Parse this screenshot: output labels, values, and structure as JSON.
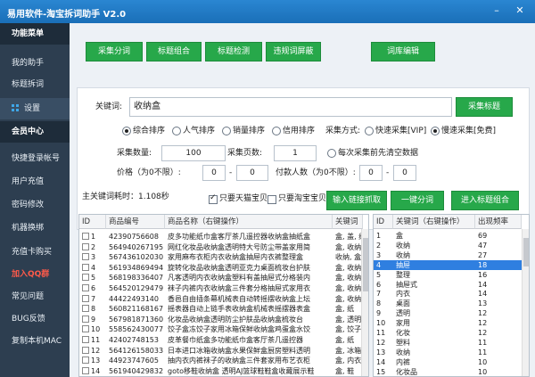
{
  "window": {
    "title": "易用软件-淘宝拆词助手 V2.0",
    "min": "–",
    "close": "✕"
  },
  "sidebar": {
    "items": [
      {
        "label": "功能菜单",
        "section": true
      },
      {
        "label": "我的助手"
      },
      {
        "label": "标题拆词"
      },
      {
        "label": "设置",
        "icon": "grid-icon",
        "active": true
      },
      {
        "label": "会员中心",
        "section": true
      },
      {
        "label": "快捷登录帐号"
      },
      {
        "label": "用户充值"
      },
      {
        "label": "密码修改"
      },
      {
        "label": "机器换绑"
      },
      {
        "label": "充值卡购买"
      },
      {
        "label": "加入QQ群",
        "red": true
      },
      {
        "label": "常见问题"
      },
      {
        "label": "BUG反馈"
      },
      {
        "label": "复制本机MAC"
      }
    ]
  },
  "toolbar": {
    "collect": "采集分词",
    "combine": "标题组合",
    "detect": "标题检测",
    "violation": "违规词屏蔽",
    "edit": "词库编辑"
  },
  "search": {
    "keyword_label": "关键词:",
    "keyword_value": "收纳盒",
    "collect_titles_btn": "采集标题",
    "sort": [
      {
        "label": "综合排序",
        "checked": true
      },
      {
        "label": "人气排序",
        "checked": false
      },
      {
        "label": "销量排序",
        "checked": false
      },
      {
        "label": "信用排序",
        "checked": false
      }
    ],
    "method_label": "采集方式:",
    "methods": [
      {
        "label": "快速采集[VIP]",
        "checked": false
      },
      {
        "label": "慢速采集[免费]",
        "checked": true
      }
    ],
    "count_label": "采集数量:",
    "count_value": "100",
    "pages_label": "采集页数:",
    "pages_value": "1",
    "clear_label": "每次采集前先清空数据",
    "price_label": "价格（为0不限）:",
    "price_min": "0",
    "price_max": "0",
    "price_dash": "-",
    "buyers_label": "付款人数（为0不限）:",
    "buyers_min": "0",
    "buyers_max": "0",
    "buyers_dash": "-"
  },
  "actions": {
    "time_label": "主关键词耗时：1.108秒",
    "tmall_only": "只要天猫宝贝",
    "taobao_only": "只要淘宝宝贝",
    "import_btn": "输入链接抓取",
    "onekey_btn": "一键分词",
    "combine_btn": "进入标题组合"
  },
  "left_table": {
    "headers": [
      "ID",
      "商品编号",
      "商品名称（右键操作）",
      "关键词"
    ],
    "rows": [
      [
        "1",
        "42390756608",
        "皮多功能纸巾盒客厅茶几遥控器收纳盒抽纸盒",
        "盒, 盖, 纸"
      ],
      [
        "2",
        "564940267195",
        "网红化妆品收纳盒透明特大号防尘带盖家用简",
        "盒, 收纳"
      ],
      [
        "3",
        "567436102030",
        "家用麻布衣柜内衣收纳盒抽屉内衣裤整理盒",
        "收纳, 盒"
      ],
      [
        "4",
        "561934869494",
        "旋转化妆品收纳盒透明亚克力桌面梳妆台护肤",
        "盒, 收纳"
      ],
      [
        "5",
        "568198336407",
        "凡客透明内衣收纳盒塑料有盖抽屉式分格装内",
        "盒, 收纳"
      ],
      [
        "6",
        "564520129479",
        "袜子内裤内衣收纳盒三件套分格抽屉式家用衣",
        "盒, 收纳"
      ],
      [
        "7",
        "44422493140",
        "香邑自由插条幕机械表自动转摇摆收纳盒上坛",
        "盒, 收纳"
      ],
      [
        "8",
        "560821168167",
        "摇表器自动上链手表收纳盒机械表摇摆器表盒",
        "盒, 纸"
      ],
      [
        "9",
        "567981871360",
        "化妆品收纳盒透明防尘护肤品收纳盒梳妆台",
        "盒, 透明"
      ],
      [
        "10",
        "558562430077",
        "饺子盒冻饺子家用冰箱保鲜收纳盒鸡蛋盒水饺",
        "盒, 饺子"
      ],
      [
        "11",
        "42402748153",
        "皮革餐巾纸盒多功能纸巾盒客厅茶几遥控器",
        "盒, 纸"
      ],
      [
        "12",
        "564126158033",
        "日本进口冰箱收纳盒水果保鲜盒厨房塑料透明",
        "盒, 冰箱"
      ],
      [
        "13",
        "44923747605",
        "抽内衣内裤袜子的收纳盒三件套家用布艺衣柜",
        "盒, 内衣"
      ],
      [
        "14",
        "561940429832",
        "goto移鞋收纳盒 透明AJ篮球鞋鞋盒收藏展示鞋",
        "盒, 鞋"
      ]
    ]
  },
  "right_table": {
    "headers": [
      "ID",
      "关键词（右键操作）",
      "出现频率"
    ],
    "rows": [
      [
        "1",
        "盒",
        "69"
      ],
      [
        "2",
        "收纳",
        "47"
      ],
      [
        "3",
        "收纳",
        "27"
      ],
      [
        "4",
        "抽屉",
        "18"
      ],
      [
        "5",
        "整理",
        "16"
      ],
      [
        "6",
        "抽屉式",
        "14"
      ],
      [
        "7",
        "内衣",
        "14"
      ],
      [
        "8",
        "桌面",
        "13"
      ],
      [
        "9",
        "透明",
        "12"
      ],
      [
        "10",
        "家用",
        "12"
      ],
      [
        "11",
        "化妆",
        "12"
      ],
      [
        "12",
        "塑料",
        "11"
      ],
      [
        "13",
        "收纳",
        "11"
      ],
      [
        "14",
        "内裤",
        "10"
      ],
      [
        "15",
        "化妆品",
        "10"
      ]
    ],
    "selected_row": 3
  },
  "colors": {
    "accent": "#27a84a",
    "sidebar": "#2d3e50",
    "titlebar": "#1a6fb8",
    "selection": "#2f7fe0"
  }
}
